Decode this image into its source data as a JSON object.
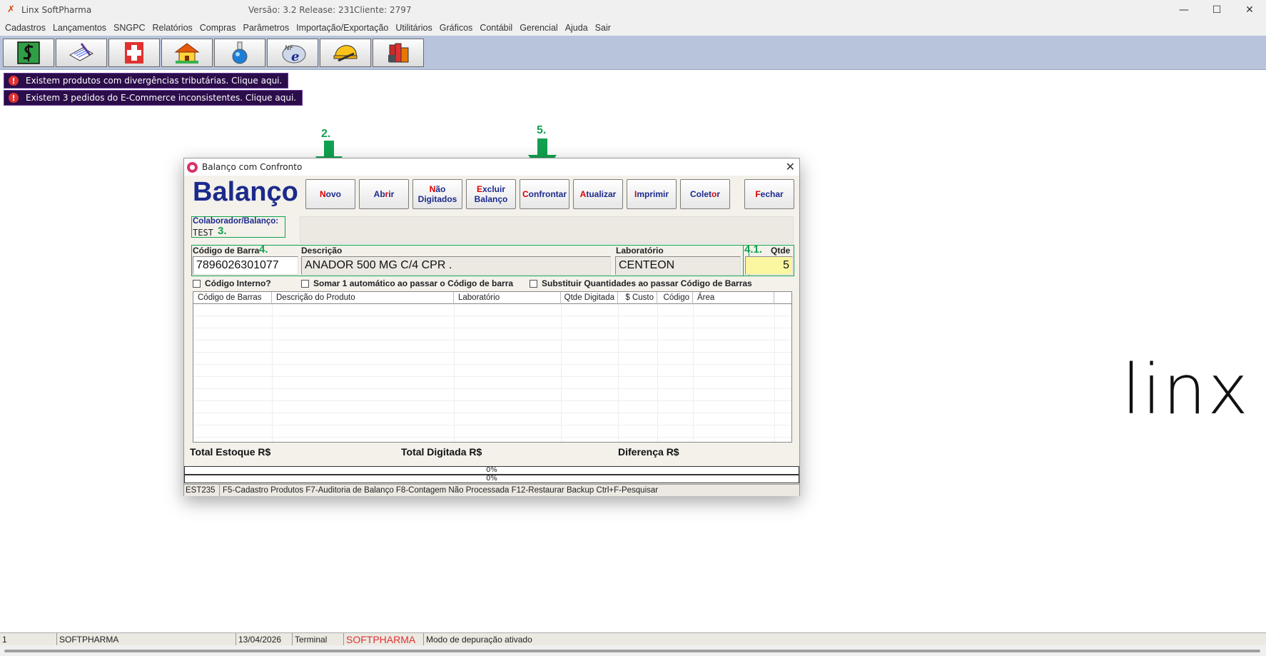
{
  "window": {
    "app_title": "Linx SoftPharma",
    "version": "Versão: 3.2 Release: 231",
    "client": "Cliente: 2797",
    "minimize": "—",
    "maximize": "☐",
    "close": "✕"
  },
  "menu": [
    "Cadastros",
    "Lançamentos",
    "SNGPC",
    "Relatórios",
    "Compras",
    "Parâmetros",
    "Importação/Exportação",
    "Utilitários",
    "Gráficos",
    "Contábil",
    "Gerencial",
    "Ajuda",
    "Sair"
  ],
  "toolbar_icons": [
    "cash-icon",
    "notepad-icon",
    "pharmacy-cross-icon",
    "house-icon",
    "flask-icon",
    "nfe-icon",
    "helmet-icon",
    "books-icon"
  ],
  "alerts": [
    "Existem produtos com divergências tributárias. Clique aqui.",
    "Existem 3 pedidos do E-Commerce inconsistentes. Clique aqui."
  ],
  "annotations": {
    "a2": "2.",
    "a3": "3.",
    "a4": "4.",
    "a41": "4.1.",
    "a5": "5.",
    "color": "#12a150"
  },
  "dialog": {
    "title": "Balanço com Confronto",
    "heading": "Balanço",
    "buttons": {
      "novo_hot": "N",
      "novo_rest": "ovo",
      "abrir_pre": "Ab",
      "abrir_hot": "r",
      "abrir_rest": "ir",
      "naodig_pre": "",
      "naodig_hot": "N",
      "naodig_rest": "ão",
      "naodig_line2": "Digitados",
      "excluir_hot": "E",
      "excluir_rest": "xcluir",
      "excluir_line2": "Balanço",
      "confrontar_hot": "C",
      "confrontar_rest": "onfrontar",
      "atualizar_hot": "A",
      "atualizar_rest": "tualizar",
      "imprimir_hot": "I",
      "imprimir_rest": "mprimir",
      "coletor_pre": "Colet",
      "coletor_hot": "o",
      "coletor_rest": "r",
      "fechar_hot": "F",
      "fechar_rest": "echar"
    },
    "colaborador_label": "Colaborador/Balanço:",
    "colaborador_value": "TEST",
    "codigo_barra_label": "Código de Barra",
    "descricao_label": "Descrição",
    "laboratorio_label": "Laboratório",
    "qtde_label": "Qtde",
    "codigo_barra_value": "7896026301077",
    "descricao_value": "ANADOR 500 MG C/4 CPR .",
    "laboratorio_value": "CENTEON",
    "qtde_value": "5",
    "chk_codigo_interno": "Código Interno?",
    "chk_somar": "Somar 1 automático ao passar o Código de barra",
    "chk_substituir": "Substituir Quantidades ao passar Código de Barras",
    "columns": [
      "Código de Barras",
      "Descrição do Produto",
      "Laboratório",
      "Qtde Digitada",
      "$ Custo",
      "Código",
      "Área"
    ],
    "total_estoque": "Total Estoque R$",
    "total_digitada": "Total Digitada R$",
    "diferenca": "Diferença R$",
    "progress1": "0%",
    "progress2": "0%",
    "status_code": "EST235",
    "status_shortcuts": "F5-Cadastro Produtos  F7-Auditoria de Balanço  F8-Contagem Não Processada  F12-Restaurar Backup  Ctrl+F-Pesquisar"
  },
  "logo": "linx",
  "statusbar": {
    "s1": "1",
    "s2": "SOFTPHARMA",
    "s3": "13/04/2026",
    "s4": "Terminal",
    "s5": "SOFTPHARMA",
    "s6": "Modo de depuração ativado"
  }
}
